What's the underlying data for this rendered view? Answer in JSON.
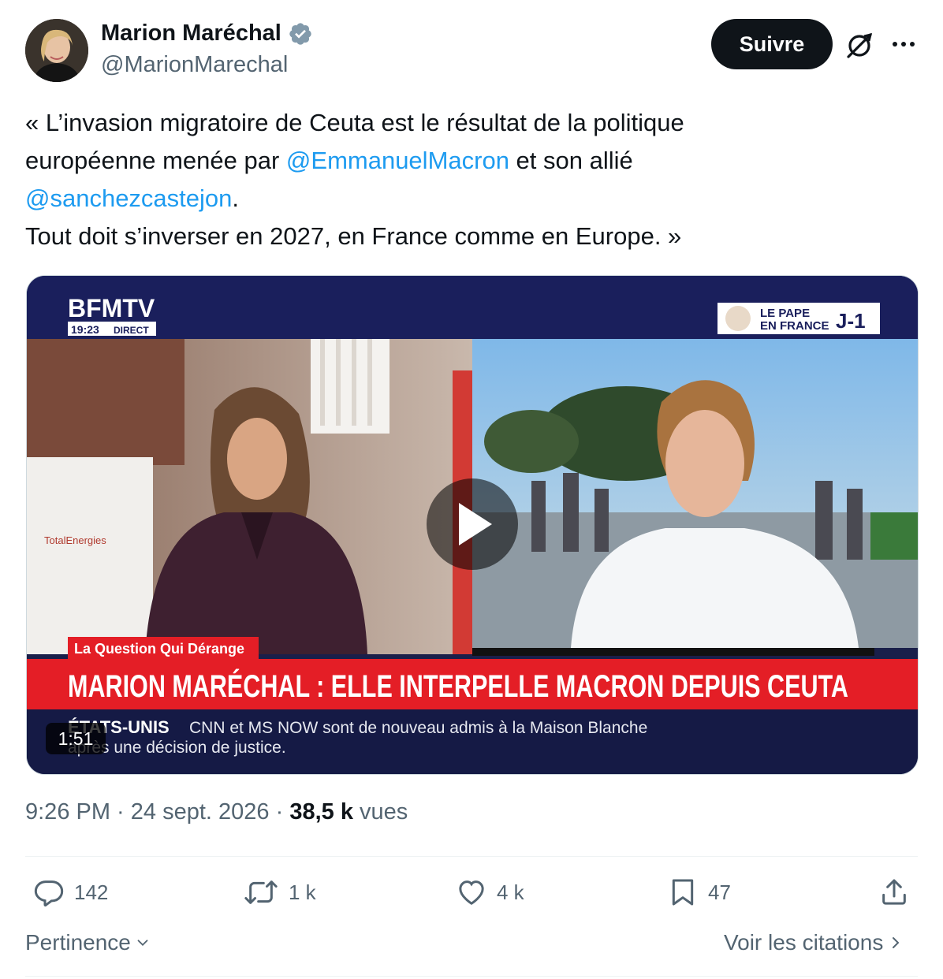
{
  "author": {
    "name": "Marion Maréchal",
    "handle": "@MarionMarechal",
    "verified": true
  },
  "header": {
    "follow_label": "Suivre",
    "icons": [
      "grok-icon",
      "more-icon"
    ]
  },
  "tweet": {
    "line1": "« L’invasion migratoire de Ceuta est le résultat de la politique",
    "line2_prefix": "européenne menée par ",
    "mention1": "@EmmanuelMacron",
    "line2_suffix": " et son allié",
    "mention2": "@sanchezcastejon",
    "line3_suffix": ".",
    "line4": "Tout doit s’inverser en 2027, en France comme en Europe. »"
  },
  "video": {
    "channel": "BFMTV",
    "time": "19:23",
    "live": "DIRECT",
    "badge_line1": "LE PAPE",
    "badge_line2": "EN FRANCE",
    "badge_countdown": "J-1",
    "segment": "La Question Qui Dérange",
    "headline": "MARION MARÉCHAL : ELLE INTERPELLE MACRON DEPUIS CEUTA",
    "ticker_label": "ÉTATS-UNIS",
    "ticker_text": "CNN et MS NOW sont de nouveau admis à la Maison Blanche",
    "ticker_text2": "après une décision de justice.",
    "logo_text": "TotalEnergies",
    "duration": "1:51"
  },
  "meta": {
    "time": "9:26 PM",
    "sep1": " · ",
    "date": "24 sept. 2026",
    "sep2": " · ",
    "views": "38,5 k",
    "views_label": " vues"
  },
  "actions": {
    "replies": "142",
    "reposts": "1 k",
    "likes": "4 k",
    "bookmarks": "47"
  },
  "footer": {
    "sort_label": "Pertinence",
    "quotes_label": "Voir les citations"
  },
  "colors": {
    "accent": "#1d9bf0",
    "text": "#0f1419",
    "muted": "#536471",
    "verified": "#829aab",
    "bfm_red": "#e41e26",
    "bfm_blue": "#1a1f5c"
  }
}
